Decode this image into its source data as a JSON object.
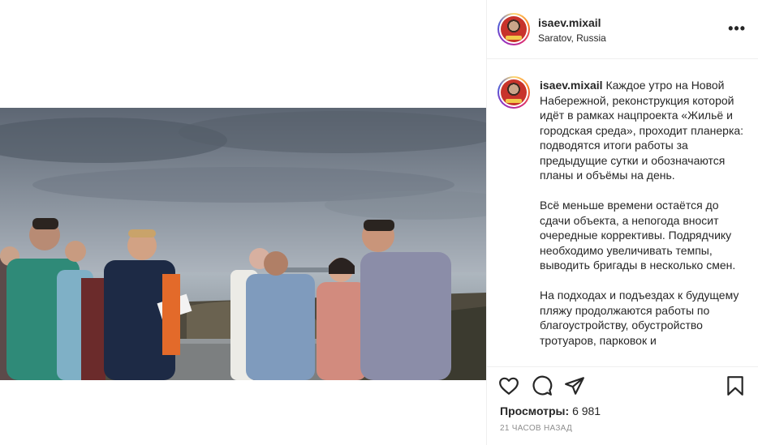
{
  "header": {
    "username": "isaev.mixail",
    "location": "Saratov, Russia",
    "more_label": "•••"
  },
  "media": {
    "description": "photo"
  },
  "caption": {
    "username": "isaev.mixail",
    "p1": "Каждое утро на Новой Набережной, реконструкция которой идёт в рамках нацпроекта «Жильё и городская среда», проходит планерка: подводятся итоги работы за предыдущие сутки и обозначаются планы и объёмы на день.",
    "p2": "Всё меньше времени остаётся до сдачи объекта, а непогода вносит очередные коррективы. Подрядчику необходимо увеличивать темпы, выводить бригады в несколько смен.",
    "p3": "На подходах и подъездах к будущему пляжу продолжаются работы по благоустройству, обустройство тротуаров, парковок и"
  },
  "actions": {
    "like_icon": "heart-icon",
    "comment_icon": "comment-icon",
    "share_icon": "share-icon",
    "save_icon": "bookmark-icon"
  },
  "stats": {
    "views_label": "Просмотры:",
    "views_count": "6 981",
    "time": "21 часов назад"
  }
}
